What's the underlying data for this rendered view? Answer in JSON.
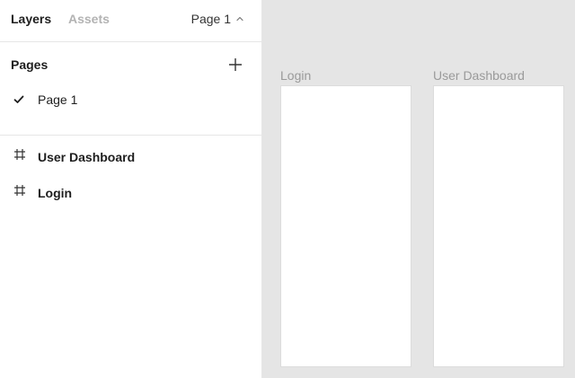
{
  "panel": {
    "tabs": [
      {
        "label": "Layers",
        "active": true
      },
      {
        "label": "Assets",
        "active": false
      }
    ],
    "page_selector": {
      "label": "Page 1"
    }
  },
  "pages": {
    "title": "Pages",
    "items": [
      {
        "label": "Page 1",
        "selected": true
      }
    ]
  },
  "layers": {
    "items": [
      {
        "label": "User Dashboard",
        "icon": "frame-icon"
      },
      {
        "label": "Login",
        "icon": "frame-icon"
      }
    ]
  },
  "canvas": {
    "background": "#e5e5e5",
    "frames": [
      {
        "title": "Login"
      },
      {
        "title": "User Dashboard"
      }
    ]
  }
}
